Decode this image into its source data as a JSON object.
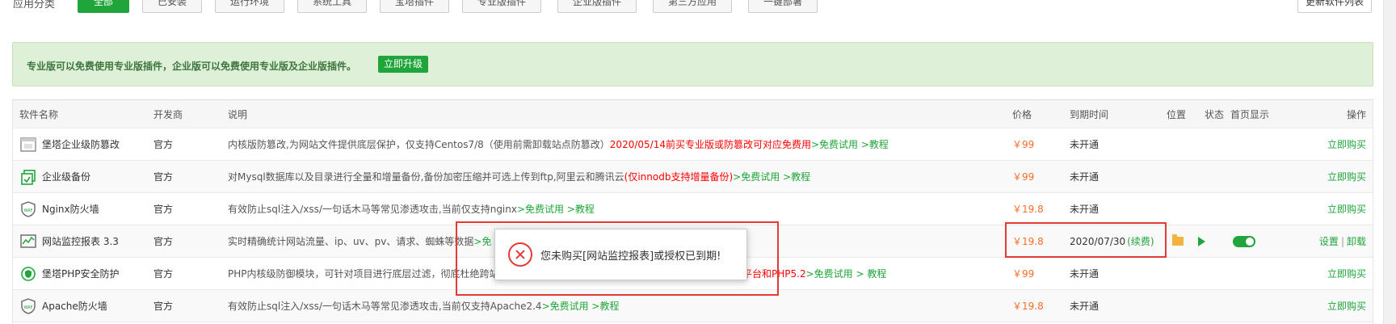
{
  "filters": {
    "label": "应用分类",
    "items": [
      "全部",
      "已安装",
      "运行环境",
      "系统工具",
      "宝塔插件",
      "专业版插件",
      "企业版插件",
      "第三方应用",
      "一键部署"
    ],
    "refresh_label": "更新软件列表"
  },
  "promo": {
    "text": "专业版可以免费使用专业版插件，企业版可以免费使用专业版及企业版插件。",
    "button": "立即升级"
  },
  "table": {
    "headers": {
      "name": "软件名称",
      "developer": "开发商",
      "description": "说明",
      "price": "价格",
      "expire": "到期时间",
      "location": "位置",
      "status": "状态",
      "homepage": "首页显示",
      "ops": "操作"
    },
    "rows": [
      {
        "name": "堡塔企业级防篡改",
        "icon": "tamper-proof-icon",
        "developer": "官方",
        "desc": "内核版防篡改,为网站文件提供底层保护，仅支持Centos7/8（使用前需卸载站点防篡改）",
        "desc_red": "2020/05/14前买专业版或防篡改可对应免费用",
        "desc_link": " >免费试用 >教程",
        "price": "￥99",
        "expire": "未开通",
        "op": "立即购买"
      },
      {
        "name": "企业级备份",
        "icon": "backup-icon",
        "developer": "官方",
        "desc": "对Mysql数据库以及目录进行全量和增量备份,备份加密压缩并可选上传到ftp,阿里云和腾讯云",
        "desc_red": "(仅innodb支持增量备份)",
        "desc_link": " >免费试用 >教程",
        "price": "￥99",
        "expire": "未开通",
        "op": "立即购买"
      },
      {
        "name": "Nginx防火墙",
        "icon": "waf-icon",
        "developer": "官方",
        "desc": "有效防止sql注入/xss/一句话木马等常见渗透攻击,当前仅支持nginx",
        "desc_red": "",
        "desc_link": " >免费试用 >教程",
        "price": "￥19.8",
        "expire": "未开通",
        "op": "立即购买"
      },
      {
        "name": "网站监控报表 3.3",
        "icon": "monitor-icon",
        "developer": "官方",
        "desc": "实时精确统计网站流量、ip、uv、pv、请求、蜘蛛等数据",
        "desc_red": "",
        "desc_link": " >免",
        "price": "￥19.8",
        "expire": "2020/07/30",
        "renew": "(续费)",
        "op_settings": "设置",
        "op_sep": "|",
        "op_uninstall": "卸载"
      },
      {
        "name": "堡塔PHP安全防护",
        "icon": "php-shield-icon",
        "developer": "官方",
        "desc": "PHP内核级防御模块，可针对项目进行底层过滤，彻底杜绝跨站",
        "desc_red": "平台和PHP5.2",
        "desc_link": " >免费试用 > 教程",
        "price": "￥99",
        "expire": "未开通",
        "op": "立即购买"
      },
      {
        "name": "Apache防火墙",
        "icon": "waf-icon",
        "developer": "官方",
        "desc": "有效防止sql注入/xss/一句话木马等常见渗透攻击,当前仅支持Apache2.4",
        "desc_red": "",
        "desc_link": " >免费试用 >教程",
        "price": "￥19.8",
        "expire": "未开通",
        "op": "立即购买"
      }
    ]
  },
  "modal": {
    "icon": "error-icon",
    "text": "您未购买[网站监控报表]或授权已到期!"
  },
  "colors": {
    "brand": "#20a53a",
    "price": "#fc6d26",
    "highlight": "#e53935"
  }
}
